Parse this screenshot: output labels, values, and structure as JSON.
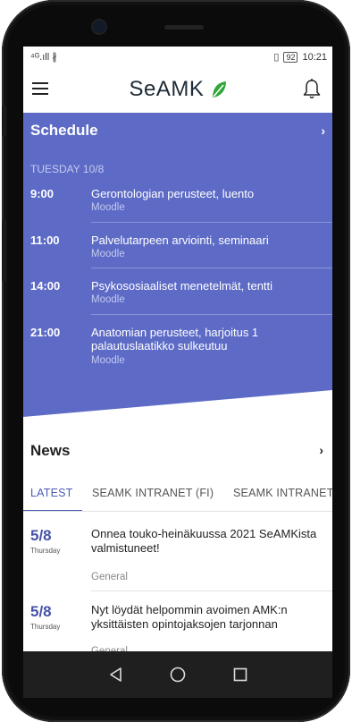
{
  "status_bar": {
    "signal": "⁴ᴳ.ıll ∦",
    "battery": "92",
    "time": "10:21"
  },
  "app_bar": {
    "logo_text": "SeAMK",
    "menu_icon": "hamburger-menu-icon",
    "bell_icon": "bell-icon"
  },
  "schedule": {
    "title": "Schedule",
    "chevron": "›",
    "day_label": "TUESDAY 10/8",
    "events": [
      {
        "time": "9:00",
        "title": "Gerontologian perusteet, luento",
        "source": "Moodle"
      },
      {
        "time": "11:00",
        "title": "Palvelutarpeen arviointi, seminaari",
        "source": "Moodle"
      },
      {
        "time": "14:00",
        "title": "Psykososiaaliset menetelmät, tentti",
        "source": "Moodle"
      },
      {
        "time": "21:00",
        "title": "Anatomian perusteet, harjoitus 1 palautuslaatikko sulkeutuu",
        "source": "Moodle"
      }
    ]
  },
  "news": {
    "title": "News",
    "chevron": "›",
    "tabs": [
      {
        "label": "LATEST",
        "active": true
      },
      {
        "label": "SEAMK INTRANET (FI)",
        "active": false
      },
      {
        "label": "SEAMK INTRANET (",
        "active": false
      }
    ],
    "items": [
      {
        "date": "5/8",
        "weekday": "Thursday",
        "headline": "Onnea touko-heinäkuussa 2021 SeAMKista valmistuneet!",
        "category": "General"
      },
      {
        "date": "5/8",
        "weekday": "Thursday",
        "headline": "Nyt löydät helpommin avoimen AMK:n yksittäisten opintojaksojen tarjonnan",
        "category": "General"
      }
    ]
  },
  "colors": {
    "schedule_bg": "#5d6bc6",
    "accent": "#4c5bb8",
    "leaf_green": "#2fa53a"
  }
}
